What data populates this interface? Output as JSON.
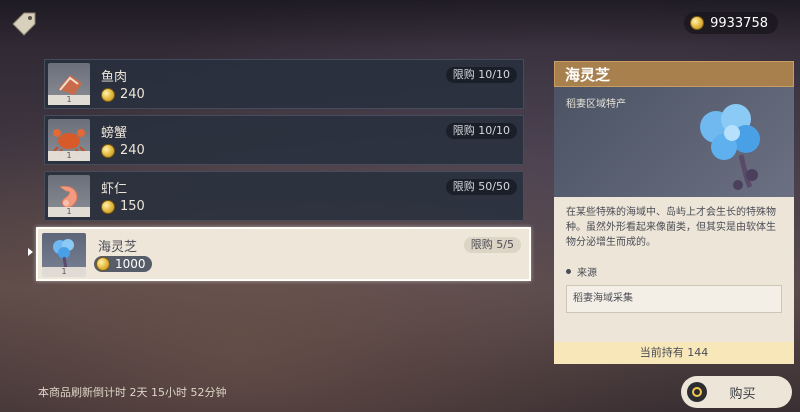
{
  "header": {
    "currency_amount": "9933758",
    "icon": "price-tag-icon"
  },
  "items": [
    {
      "name": "鱼肉",
      "price": "240",
      "limit": "限购 10/10",
      "qty": "1",
      "icon": "fish-meat-icon"
    },
    {
      "name": "螃蟹",
      "price": "240",
      "limit": "限购 10/10",
      "qty": "1",
      "icon": "crab-icon"
    },
    {
      "name": "虾仁",
      "price": "150",
      "limit": "限购 50/50",
      "qty": "1",
      "icon": "shrimp-icon"
    },
    {
      "name": "海灵芝",
      "price": "1000",
      "limit": "限购 5/5",
      "qty": "1",
      "icon": "sea-ganoderma-icon"
    }
  ],
  "detail": {
    "title": "海灵芝",
    "region": "稻妻区域特产",
    "description": "在某些特殊的海域中、岛屿上才会生长的特殊物种。虽然外形看起来像菌类，但其实是由软体生物分泌增生而成的。",
    "source_title": "来源",
    "source": "稻妻海域采集",
    "owned": "当前持有 144"
  },
  "footer": {
    "refresh_text": "本商品刷新倒计时 2天 15小时 52分钟",
    "buy_label": "购买"
  },
  "colors": {
    "accent_gold": "#a7804e",
    "panel_cream": "#ece5d8",
    "row_dark": "#28303e"
  }
}
